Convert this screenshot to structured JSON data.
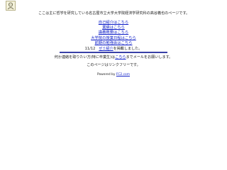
{
  "header": {
    "intro": "ここは主に哲学を研究している名古屋市立大学大学院経済学研究科の高谷義也のページです。"
  },
  "links": [
    "自己紹介はこちら",
    "業績はこちら",
    "講義概要はこちら",
    "大学院の授業日程はこちら",
    "前期の勉強会はこちら"
  ],
  "update": {
    "date": "11/12",
    "link": "ゼミ紹介",
    "suffix": "を掲載しました。"
  },
  "contact": {
    "prefix": "何か連絡を取りたい方(特に卒業生)は",
    "link": "こちら",
    "suffix": "までメールをお願いします。"
  },
  "linkfree": "このページはリンクフリーです。",
  "powered": {
    "prefix": "Powered by",
    "link": "FC2.com"
  },
  "colors": {
    "link": "#1020c8",
    "rule": "#3940a6"
  }
}
